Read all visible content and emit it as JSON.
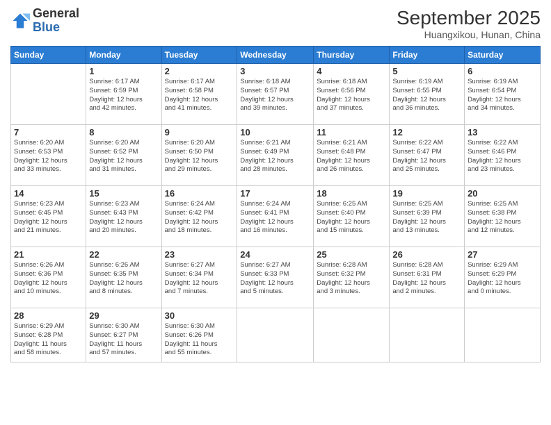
{
  "logo": {
    "general": "General",
    "blue": "Blue"
  },
  "header": {
    "month": "September 2025",
    "location": "Huangxikou, Hunan, China"
  },
  "days_of_week": [
    "Sunday",
    "Monday",
    "Tuesday",
    "Wednesday",
    "Thursday",
    "Friday",
    "Saturday"
  ],
  "weeks": [
    [
      {
        "day": "",
        "info": ""
      },
      {
        "day": "1",
        "info": "Sunrise: 6:17 AM\nSunset: 6:59 PM\nDaylight: 12 hours\nand 42 minutes."
      },
      {
        "day": "2",
        "info": "Sunrise: 6:17 AM\nSunset: 6:58 PM\nDaylight: 12 hours\nand 41 minutes."
      },
      {
        "day": "3",
        "info": "Sunrise: 6:18 AM\nSunset: 6:57 PM\nDaylight: 12 hours\nand 39 minutes."
      },
      {
        "day": "4",
        "info": "Sunrise: 6:18 AM\nSunset: 6:56 PM\nDaylight: 12 hours\nand 37 minutes."
      },
      {
        "day": "5",
        "info": "Sunrise: 6:19 AM\nSunset: 6:55 PM\nDaylight: 12 hours\nand 36 minutes."
      },
      {
        "day": "6",
        "info": "Sunrise: 6:19 AM\nSunset: 6:54 PM\nDaylight: 12 hours\nand 34 minutes."
      }
    ],
    [
      {
        "day": "7",
        "info": "Sunrise: 6:20 AM\nSunset: 6:53 PM\nDaylight: 12 hours\nand 33 minutes."
      },
      {
        "day": "8",
        "info": "Sunrise: 6:20 AM\nSunset: 6:52 PM\nDaylight: 12 hours\nand 31 minutes."
      },
      {
        "day": "9",
        "info": "Sunrise: 6:20 AM\nSunset: 6:50 PM\nDaylight: 12 hours\nand 29 minutes."
      },
      {
        "day": "10",
        "info": "Sunrise: 6:21 AM\nSunset: 6:49 PM\nDaylight: 12 hours\nand 28 minutes."
      },
      {
        "day": "11",
        "info": "Sunrise: 6:21 AM\nSunset: 6:48 PM\nDaylight: 12 hours\nand 26 minutes."
      },
      {
        "day": "12",
        "info": "Sunrise: 6:22 AM\nSunset: 6:47 PM\nDaylight: 12 hours\nand 25 minutes."
      },
      {
        "day": "13",
        "info": "Sunrise: 6:22 AM\nSunset: 6:46 PM\nDaylight: 12 hours\nand 23 minutes."
      }
    ],
    [
      {
        "day": "14",
        "info": "Sunrise: 6:23 AM\nSunset: 6:45 PM\nDaylight: 12 hours\nand 21 minutes."
      },
      {
        "day": "15",
        "info": "Sunrise: 6:23 AM\nSunset: 6:43 PM\nDaylight: 12 hours\nand 20 minutes."
      },
      {
        "day": "16",
        "info": "Sunrise: 6:24 AM\nSunset: 6:42 PM\nDaylight: 12 hours\nand 18 minutes."
      },
      {
        "day": "17",
        "info": "Sunrise: 6:24 AM\nSunset: 6:41 PM\nDaylight: 12 hours\nand 16 minutes."
      },
      {
        "day": "18",
        "info": "Sunrise: 6:25 AM\nSunset: 6:40 PM\nDaylight: 12 hours\nand 15 minutes."
      },
      {
        "day": "19",
        "info": "Sunrise: 6:25 AM\nSunset: 6:39 PM\nDaylight: 12 hours\nand 13 minutes."
      },
      {
        "day": "20",
        "info": "Sunrise: 6:25 AM\nSunset: 6:38 PM\nDaylight: 12 hours\nand 12 minutes."
      }
    ],
    [
      {
        "day": "21",
        "info": "Sunrise: 6:26 AM\nSunset: 6:36 PM\nDaylight: 12 hours\nand 10 minutes."
      },
      {
        "day": "22",
        "info": "Sunrise: 6:26 AM\nSunset: 6:35 PM\nDaylight: 12 hours\nand 8 minutes."
      },
      {
        "day": "23",
        "info": "Sunrise: 6:27 AM\nSunset: 6:34 PM\nDaylight: 12 hours\nand 7 minutes."
      },
      {
        "day": "24",
        "info": "Sunrise: 6:27 AM\nSunset: 6:33 PM\nDaylight: 12 hours\nand 5 minutes."
      },
      {
        "day": "25",
        "info": "Sunrise: 6:28 AM\nSunset: 6:32 PM\nDaylight: 12 hours\nand 3 minutes."
      },
      {
        "day": "26",
        "info": "Sunrise: 6:28 AM\nSunset: 6:31 PM\nDaylight: 12 hours\nand 2 minutes."
      },
      {
        "day": "27",
        "info": "Sunrise: 6:29 AM\nSunset: 6:29 PM\nDaylight: 12 hours\nand 0 minutes."
      }
    ],
    [
      {
        "day": "28",
        "info": "Sunrise: 6:29 AM\nSunset: 6:28 PM\nDaylight: 11 hours\nand 58 minutes."
      },
      {
        "day": "29",
        "info": "Sunrise: 6:30 AM\nSunset: 6:27 PM\nDaylight: 11 hours\nand 57 minutes."
      },
      {
        "day": "30",
        "info": "Sunrise: 6:30 AM\nSunset: 6:26 PM\nDaylight: 11 hours\nand 55 minutes."
      },
      {
        "day": "",
        "info": ""
      },
      {
        "day": "",
        "info": ""
      },
      {
        "day": "",
        "info": ""
      },
      {
        "day": "",
        "info": ""
      }
    ]
  ]
}
